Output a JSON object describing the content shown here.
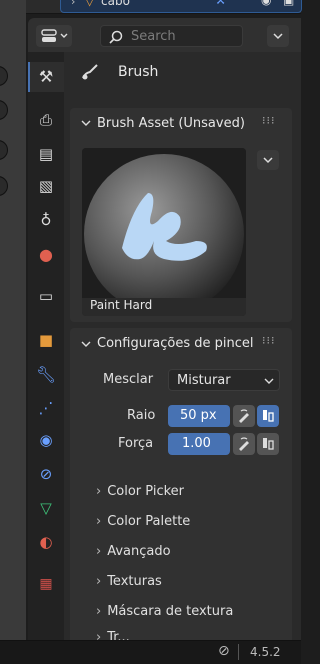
{
  "outliner": {
    "object_name": "cabo"
  },
  "header": {
    "search_placeholder": "Search"
  },
  "brush_tab": {
    "title": "Brush"
  },
  "brush_asset": {
    "header": "Brush Asset (Unsaved)",
    "preview_name": "Paint Hard"
  },
  "brush_settings": {
    "header": "Configurações de pincel",
    "blend_label": "Mesclar",
    "blend_value": "Misturar",
    "radius_label": "Raio",
    "radius_value": "50 px",
    "strength_label": "Força",
    "strength_value": "1.00"
  },
  "subpanels": [
    "Color Picker",
    "Color Palette",
    "Avançado",
    "Texturas",
    "Máscara de textura",
    "Tr..."
  ],
  "status": {
    "version": "4.5.2"
  },
  "colors": {
    "accent": "#4772b3",
    "panel": "#313131",
    "background": "#1d1d1d",
    "selection": "#1f3350"
  }
}
